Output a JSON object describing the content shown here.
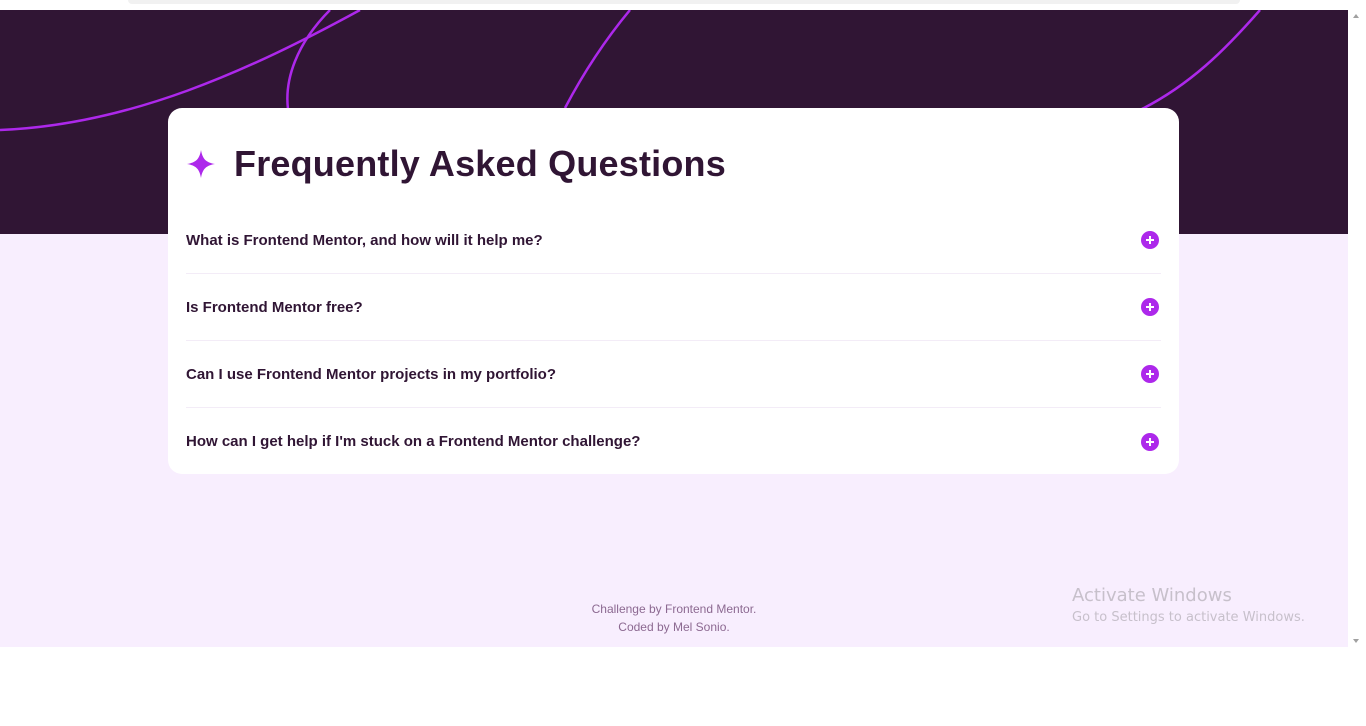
{
  "colors": {
    "hero_bg": "#301534",
    "page_bg": "#f8eefe",
    "accent": "#ad28eb",
    "text_dark": "#301534",
    "footer_text": "#8c6991"
  },
  "card": {
    "icon": "star-icon",
    "title": "Frequently Asked Questions"
  },
  "faq": [
    {
      "question": "What is Frontend Mentor, and how will it help me?",
      "icon": "plus-icon"
    },
    {
      "question": "Is Frontend Mentor free?",
      "icon": "plus-icon"
    },
    {
      "question": "Can I use Frontend Mentor projects in my portfolio?",
      "icon": "plus-icon"
    },
    {
      "question": "How can I get help if I'm stuck on a Frontend Mentor challenge?",
      "icon": "plus-icon"
    }
  ],
  "footer": {
    "line1": "Challenge by Frontend Mentor.",
    "line2": "Coded by Mel Sonio."
  },
  "watermark": {
    "title": "Activate Windows",
    "subtitle": "Go to Settings to activate Windows."
  }
}
